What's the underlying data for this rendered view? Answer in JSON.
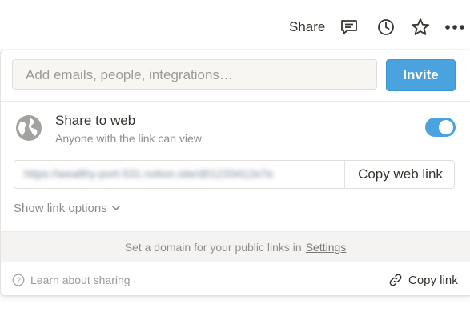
{
  "topbar": {
    "share_label": "Share",
    "icons": [
      "comment-icon",
      "clock-history-icon",
      "star-icon",
      "more-icon"
    ]
  },
  "invite": {
    "placeholder": "Add emails, people, integrations…",
    "button_label": "Invite"
  },
  "share_to_web": {
    "title": "Share to web",
    "subtitle": "Anyone with the link can view",
    "enabled": true,
    "link_url": "https://wealthy-port-531.notion.site/d01233412e7e",
    "copy_button_label": "Copy web link"
  },
  "link_options_label": "Show link options",
  "domain_notice": {
    "text": "Set a domain for your public links in",
    "link_label": "Settings"
  },
  "footer": {
    "learn_label": "Learn about sharing",
    "copy_link_label": "Copy link"
  },
  "colors": {
    "accent": "#4aa3de",
    "text": "#37352f",
    "muted": "#8f8e8a"
  }
}
